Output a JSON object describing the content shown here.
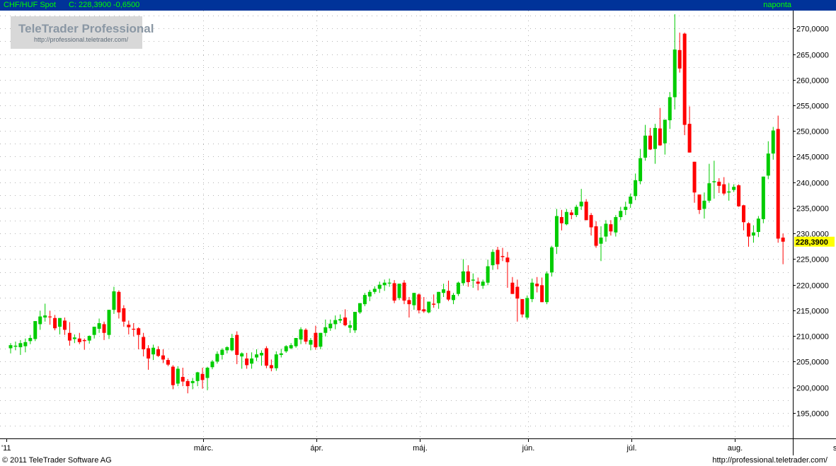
{
  "header": {
    "title": "CHF/HUF Spot",
    "info": "C: 228,3900 -0,6500",
    "frequency": "naponta",
    "background": "#003399",
    "text_color": "#00ff00"
  },
  "logo": {
    "name": "TeleTrader Professional",
    "url": "http://professional.teletrader.com/"
  },
  "footer": {
    "copyright": "© 2011 TeleTrader Software AG",
    "url": "http://professional.teletrader.com/"
  },
  "chart_data": {
    "type": "candlestick",
    "instrument": "CHF/HUF Spot",
    "frequency": "daily",
    "last_price_label": "228,3900",
    "colors": {
      "up": "#00cc00",
      "down": "#ff0000",
      "last_label": "#ffff00"
    },
    "ylim": [
      190,
      273.5
    ],
    "yticks": [
      195,
      200,
      205,
      210,
      215,
      220,
      225,
      230,
      235,
      240,
      245,
      250,
      255,
      260,
      265,
      270
    ],
    "ytick_labels": [
      "195,0000",
      "200,0000",
      "205,0000",
      "210,0000",
      "215,0000",
      "220,0000",
      "225,0000",
      "230,0000",
      "235,0000",
      "240,0000",
      "245,0000",
      "250,0000",
      "255,0000",
      "260,0000",
      "265,0000",
      "270,0000"
    ],
    "xlabels": [
      {
        "label": "'11",
        "index": 0
      },
      {
        "label": "márc.",
        "index": 40
      },
      {
        "label": "ápr.",
        "index": 63
      },
      {
        "label": "máj.",
        "index": 84
      },
      {
        "label": "jún.",
        "index": 106
      },
      {
        "label": "júl.",
        "index": 127
      },
      {
        "label": "aug.",
        "index": 148
      },
      {
        "label": "szept.",
        "index": 170
      }
    ],
    "candles": [
      {
        "o": 207.6,
        "h": 208.6,
        "l": 206.6,
        "c": 208.2
      },
      {
        "o": 207.9,
        "h": 208.9,
        "l": 207.2,
        "c": 208.1
      },
      {
        "o": 207.8,
        "h": 209.2,
        "l": 206.3,
        "c": 208.6
      },
      {
        "o": 208.0,
        "h": 209.5,
        "l": 206.8,
        "c": 208.8
      },
      {
        "o": 209.0,
        "h": 210.2,
        "l": 208.4,
        "c": 209.6
      },
      {
        "o": 209.4,
        "h": 212.4,
        "l": 209.0,
        "c": 212.9
      },
      {
        "o": 212.3,
        "h": 214.9,
        "l": 211.2,
        "c": 213.8
      },
      {
        "o": 213.6,
        "h": 216.3,
        "l": 212.8,
        "c": 214.0
      },
      {
        "o": 213.8,
        "h": 214.9,
        "l": 212.2,
        "c": 213.7
      },
      {
        "o": 213.5,
        "h": 214.1,
        "l": 211.1,
        "c": 211.5
      },
      {
        "o": 211.8,
        "h": 213.2,
        "l": 210.3,
        "c": 213.5
      },
      {
        "o": 213.0,
        "h": 213.6,
        "l": 210.2,
        "c": 211.2
      },
      {
        "o": 210.6,
        "h": 212.7,
        "l": 208.1,
        "c": 209.1
      },
      {
        "o": 209.4,
        "h": 210.3,
        "l": 208.6,
        "c": 209.7
      },
      {
        "o": 209.5,
        "h": 210.6,
        "l": 208.4,
        "c": 208.8
      },
      {
        "o": 209.2,
        "h": 209.5,
        "l": 207.3,
        "c": 209.0
      },
      {
        "o": 209.1,
        "h": 210.1,
        "l": 208.5,
        "c": 210.0
      },
      {
        "o": 210.2,
        "h": 211.6,
        "l": 209.5,
        "c": 211.8
      },
      {
        "o": 211.4,
        "h": 213.4,
        "l": 210.6,
        "c": 212.5
      },
      {
        "o": 212.3,
        "h": 212.8,
        "l": 209.2,
        "c": 210.6
      },
      {
        "o": 210.2,
        "h": 214.5,
        "l": 209.4,
        "c": 215.1
      },
      {
        "o": 215.1,
        "h": 219.6,
        "l": 214.3,
        "c": 218.7
      },
      {
        "o": 218.6,
        "h": 218.9,
        "l": 213.4,
        "c": 214.6
      },
      {
        "o": 215.4,
        "h": 216.0,
        "l": 211.8,
        "c": 212.8
      },
      {
        "o": 212.2,
        "h": 213.0,
        "l": 210.3,
        "c": 211.7
      },
      {
        "o": 211.4,
        "h": 212.5,
        "l": 209.9,
        "c": 211.3
      },
      {
        "o": 211.5,
        "h": 211.7,
        "l": 207.4,
        "c": 210.2
      },
      {
        "o": 209.8,
        "h": 210.6,
        "l": 206.0,
        "c": 207.4
      },
      {
        "o": 207.6,
        "h": 208.2,
        "l": 203.4,
        "c": 205.6
      },
      {
        "o": 206.4,
        "h": 208.3,
        "l": 205.3,
        "c": 207.7
      },
      {
        "o": 207.4,
        "h": 208.0,
        "l": 205.9,
        "c": 206.1
      },
      {
        "o": 206.2,
        "h": 207.4,
        "l": 204.7,
        "c": 205.4
      },
      {
        "o": 205.3,
        "h": 205.7,
        "l": 204.1,
        "c": 204.4
      },
      {
        "o": 204.0,
        "h": 204.3,
        "l": 199.6,
        "c": 200.4
      },
      {
        "o": 200.7,
        "h": 204.1,
        "l": 200.2,
        "c": 203.6
      },
      {
        "o": 202.0,
        "h": 203.8,
        "l": 200.2,
        "c": 201.1
      },
      {
        "o": 201.2,
        "h": 201.6,
        "l": 198.8,
        "c": 200.2
      },
      {
        "o": 200.8,
        "h": 201.8,
        "l": 199.6,
        "c": 201.2
      },
      {
        "o": 201.2,
        "h": 203.0,
        "l": 200.2,
        "c": 202.9
      },
      {
        "o": 202.6,
        "h": 203.8,
        "l": 199.7,
        "c": 201.4
      },
      {
        "o": 201.8,
        "h": 204.0,
        "l": 199.4,
        "c": 203.8
      },
      {
        "o": 203.9,
        "h": 205.3,
        "l": 203.5,
        "c": 205.0
      },
      {
        "o": 205.0,
        "h": 207.0,
        "l": 204.6,
        "c": 206.5
      },
      {
        "o": 206.3,
        "h": 207.6,
        "l": 205.4,
        "c": 207.3
      },
      {
        "o": 207.2,
        "h": 208.0,
        "l": 206.6,
        "c": 207.8
      },
      {
        "o": 207.2,
        "h": 210.4,
        "l": 207.0,
        "c": 209.6
      },
      {
        "o": 210.2,
        "h": 210.9,
        "l": 204.5,
        "c": 206.3
      },
      {
        "o": 206.0,
        "h": 206.8,
        "l": 203.6,
        "c": 206.6
      },
      {
        "o": 205.6,
        "h": 206.7,
        "l": 203.6,
        "c": 204.3
      },
      {
        "o": 204.6,
        "h": 206.8,
        "l": 203.6,
        "c": 205.6
      },
      {
        "o": 205.8,
        "h": 207.4,
        "l": 205.1,
        "c": 206.4
      },
      {
        "o": 206.2,
        "h": 207.2,
        "l": 204.2,
        "c": 206.7
      },
      {
        "o": 207.6,
        "h": 208.0,
        "l": 203.7,
        "c": 204.2
      },
      {
        "o": 204.3,
        "h": 205.4,
        "l": 203.1,
        "c": 203.7
      },
      {
        "o": 203.7,
        "h": 207.0,
        "l": 203.2,
        "c": 206.4
      },
      {
        "o": 206.3,
        "h": 207.5,
        "l": 205.8,
        "c": 206.6
      },
      {
        "o": 207.0,
        "h": 208.2,
        "l": 206.7,
        "c": 208.0
      },
      {
        "o": 207.6,
        "h": 208.6,
        "l": 207.4,
        "c": 208.2
      },
      {
        "o": 208.0,
        "h": 209.5,
        "l": 207.7,
        "c": 209.6
      },
      {
        "o": 209.3,
        "h": 211.7,
        "l": 208.4,
        "c": 211.3
      },
      {
        "o": 211.2,
        "h": 211.5,
        "l": 208.4,
        "c": 208.9
      },
      {
        "o": 208.3,
        "h": 209.6,
        "l": 207.2,
        "c": 209.2
      },
      {
        "o": 210.6,
        "h": 212.0,
        "l": 207.3,
        "c": 207.8
      },
      {
        "o": 207.9,
        "h": 210.6,
        "l": 207.4,
        "c": 210.6
      },
      {
        "o": 210.6,
        "h": 213.2,
        "l": 209.9,
        "c": 211.7
      },
      {
        "o": 211.5,
        "h": 213.2,
        "l": 211.0,
        "c": 212.4
      },
      {
        "o": 212.3,
        "h": 214.0,
        "l": 211.3,
        "c": 213.1
      },
      {
        "o": 213.0,
        "h": 214.2,
        "l": 212.5,
        "c": 213.3
      },
      {
        "o": 213.6,
        "h": 215.2,
        "l": 211.9,
        "c": 212.1
      },
      {
        "o": 211.6,
        "h": 213.0,
        "l": 210.6,
        "c": 212.1
      },
      {
        "o": 211.1,
        "h": 213.2,
        "l": 210.6,
        "c": 214.7
      },
      {
        "o": 214.6,
        "h": 216.4,
        "l": 214.3,
        "c": 216.4
      },
      {
        "o": 216.2,
        "h": 218.4,
        "l": 215.8,
        "c": 218.0
      },
      {
        "o": 217.7,
        "h": 219.0,
        "l": 216.8,
        "c": 218.6
      },
      {
        "o": 218.6,
        "h": 219.7,
        "l": 218.2,
        "c": 219.2
      },
      {
        "o": 219.2,
        "h": 220.6,
        "l": 218.4,
        "c": 220.0
      },
      {
        "o": 219.9,
        "h": 221.0,
        "l": 218.8,
        "c": 220.4
      },
      {
        "o": 220.3,
        "h": 221.2,
        "l": 219.6,
        "c": 220.4
      },
      {
        "o": 220.3,
        "h": 220.9,
        "l": 216.4,
        "c": 216.9
      },
      {
        "o": 217.4,
        "h": 220.2,
        "l": 217.0,
        "c": 220.2
      },
      {
        "o": 220.4,
        "h": 220.9,
        "l": 216.2,
        "c": 216.9
      },
      {
        "o": 217.0,
        "h": 217.6,
        "l": 213.6,
        "c": 216.2
      },
      {
        "o": 216.0,
        "h": 217.6,
        "l": 215.1,
        "c": 218.4
      },
      {
        "o": 218.1,
        "h": 218.3,
        "l": 214.4,
        "c": 215.0
      },
      {
        "o": 215.2,
        "h": 217.6,
        "l": 214.5,
        "c": 214.8
      },
      {
        "o": 214.6,
        "h": 216.4,
        "l": 214.4,
        "c": 216.7
      },
      {
        "o": 216.3,
        "h": 218.1,
        "l": 215.5,
        "c": 216.1
      },
      {
        "o": 216.4,
        "h": 218.4,
        "l": 215.3,
        "c": 218.6
      },
      {
        "o": 218.4,
        "h": 220.2,
        "l": 217.6,
        "c": 219.1
      },
      {
        "o": 218.8,
        "h": 220.8,
        "l": 216.8,
        "c": 217.1
      },
      {
        "o": 217.0,
        "h": 218.4,
        "l": 216.2,
        "c": 218.0
      },
      {
        "o": 218.2,
        "h": 220.6,
        "l": 217.8,
        "c": 220.4
      },
      {
        "o": 220.3,
        "h": 225.0,
        "l": 219.8,
        "c": 222.6
      },
      {
        "o": 222.6,
        "h": 223.8,
        "l": 219.6,
        "c": 220.5
      },
      {
        "o": 220.8,
        "h": 222.2,
        "l": 219.4,
        "c": 221.0
      },
      {
        "o": 220.6,
        "h": 221.4,
        "l": 218.9,
        "c": 220.2
      },
      {
        "o": 219.8,
        "h": 221.0,
        "l": 219.2,
        "c": 220.6
      },
      {
        "o": 220.4,
        "h": 224.9,
        "l": 219.9,
        "c": 223.6
      },
      {
        "o": 223.8,
        "h": 226.9,
        "l": 222.9,
        "c": 226.4
      },
      {
        "o": 226.8,
        "h": 227.4,
        "l": 223.0,
        "c": 224.0
      },
      {
        "o": 225.6,
        "h": 227.2,
        "l": 224.6,
        "c": 225.4
      },
      {
        "o": 225.3,
        "h": 226.4,
        "l": 219.4,
        "c": 224.4
      },
      {
        "o": 220.4,
        "h": 221.5,
        "l": 218.5,
        "c": 218.2
      },
      {
        "o": 219.6,
        "h": 221.0,
        "l": 212.8,
        "c": 217.3
      },
      {
        "o": 217.2,
        "h": 216.2,
        "l": 213.6,
        "c": 214.2
      },
      {
        "o": 213.6,
        "h": 217.9,
        "l": 213.2,
        "c": 217.4
      },
      {
        "o": 217.2,
        "h": 221.2,
        "l": 216.6,
        "c": 220.4
      },
      {
        "o": 220.2,
        "h": 221.5,
        "l": 218.5,
        "c": 219.7
      },
      {
        "o": 219.9,
        "h": 221.4,
        "l": 216.9,
        "c": 216.6
      },
      {
        "o": 216.6,
        "h": 222.6,
        "l": 216.2,
        "c": 222.2
      },
      {
        "o": 222.4,
        "h": 227.6,
        "l": 221.6,
        "c": 227.3
      },
      {
        "o": 227.4,
        "h": 234.8,
        "l": 226.0,
        "c": 233.4
      },
      {
        "o": 233.2,
        "h": 234.6,
        "l": 230.6,
        "c": 232.0
      },
      {
        "o": 231.8,
        "h": 234.8,
        "l": 231.6,
        "c": 234.2
      },
      {
        "o": 234.1,
        "h": 234.6,
        "l": 232.8,
        "c": 233.6
      },
      {
        "o": 233.6,
        "h": 235.6,
        "l": 233.2,
        "c": 235.2
      },
      {
        "o": 235.3,
        "h": 238.7,
        "l": 234.6,
        "c": 236.2
      },
      {
        "o": 236.2,
        "h": 236.7,
        "l": 233.4,
        "c": 232.6
      },
      {
        "o": 233.6,
        "h": 234.0,
        "l": 229.6,
        "c": 231.2
      },
      {
        "o": 231.4,
        "h": 232.4,
        "l": 227.2,
        "c": 227.6
      },
      {
        "o": 228.0,
        "h": 231.4,
        "l": 224.6,
        "c": 229.2
      },
      {
        "o": 229.4,
        "h": 232.6,
        "l": 228.4,
        "c": 231.9
      },
      {
        "o": 231.8,
        "h": 232.6,
        "l": 229.6,
        "c": 230.4
      },
      {
        "o": 230.2,
        "h": 233.6,
        "l": 229.4,
        "c": 233.2
      },
      {
        "o": 233.2,
        "h": 235.2,
        "l": 232.6,
        "c": 234.4
      },
      {
        "o": 234.6,
        "h": 236.2,
        "l": 233.6,
        "c": 235.2
      },
      {
        "o": 235.8,
        "h": 237.8,
        "l": 235.0,
        "c": 237.2
      },
      {
        "o": 237.3,
        "h": 241.7,
        "l": 236.5,
        "c": 240.4
      },
      {
        "o": 240.2,
        "h": 246.5,
        "l": 239.6,
        "c": 244.7
      },
      {
        "o": 244.8,
        "h": 251.2,
        "l": 244.2,
        "c": 249.1
      },
      {
        "o": 249.1,
        "h": 250.6,
        "l": 246.3,
        "c": 246.4
      },
      {
        "o": 246.5,
        "h": 251.4,
        "l": 243.6,
        "c": 250.6
      },
      {
        "o": 250.5,
        "h": 254.5,
        "l": 247.1,
        "c": 247.2
      },
      {
        "o": 247.6,
        "h": 252.0,
        "l": 245.4,
        "c": 252.2
      },
      {
        "o": 252.1,
        "h": 257.6,
        "l": 250.4,
        "c": 256.6
      },
      {
        "o": 256.6,
        "h": 272.8,
        "l": 254.2,
        "c": 265.9
      },
      {
        "o": 265.8,
        "h": 269.2,
        "l": 261.4,
        "c": 262.2
      },
      {
        "o": 269.0,
        "h": 269.2,
        "l": 249.2,
        "c": 251.2
      },
      {
        "o": 251.4,
        "h": 254.8,
        "l": 246.6,
        "c": 245.8
      },
      {
        "o": 244.0,
        "h": 243.8,
        "l": 236.0,
        "c": 238.0
      },
      {
        "o": 237.6,
        "h": 237.5,
        "l": 233.8,
        "c": 234.6
      },
      {
        "o": 234.8,
        "h": 238.0,
        "l": 232.9,
        "c": 236.4
      },
      {
        "o": 236.4,
        "h": 243.6,
        "l": 236.0,
        "c": 239.8
      },
      {
        "o": 240.0,
        "h": 244.2,
        "l": 236.8,
        "c": 240.2
      },
      {
        "o": 240.1,
        "h": 240.8,
        "l": 237.9,
        "c": 239.3
      },
      {
        "o": 239.6,
        "h": 241.0,
        "l": 237.5,
        "c": 237.8
      },
      {
        "o": 238.0,
        "h": 239.8,
        "l": 236.4,
        "c": 238.2
      },
      {
        "o": 238.5,
        "h": 239.6,
        "l": 238.1,
        "c": 239.1
      },
      {
        "o": 239.4,
        "h": 239.6,
        "l": 235.2,
        "c": 235.3
      },
      {
        "o": 235.5,
        "h": 235.6,
        "l": 230.6,
        "c": 232.2
      },
      {
        "o": 232.0,
        "h": 232.2,
        "l": 227.4,
        "c": 229.4
      },
      {
        "o": 229.6,
        "h": 231.6,
        "l": 228.2,
        "c": 230.2
      },
      {
        "o": 230.3,
        "h": 233.4,
        "l": 229.3,
        "c": 232.9
      },
      {
        "o": 232.8,
        "h": 240.4,
        "l": 232.0,
        "c": 241.1
      },
      {
        "o": 241.3,
        "h": 248.0,
        "l": 240.6,
        "c": 245.6
      },
      {
        "o": 245.6,
        "h": 250.8,
        "l": 244.4,
        "c": 250.1
      },
      {
        "o": 250.4,
        "h": 253.0,
        "l": 228.2,
        "c": 229.0
      },
      {
        "o": 229.2,
        "h": 230.0,
        "l": 224.0,
        "c": 228.4
      }
    ]
  }
}
